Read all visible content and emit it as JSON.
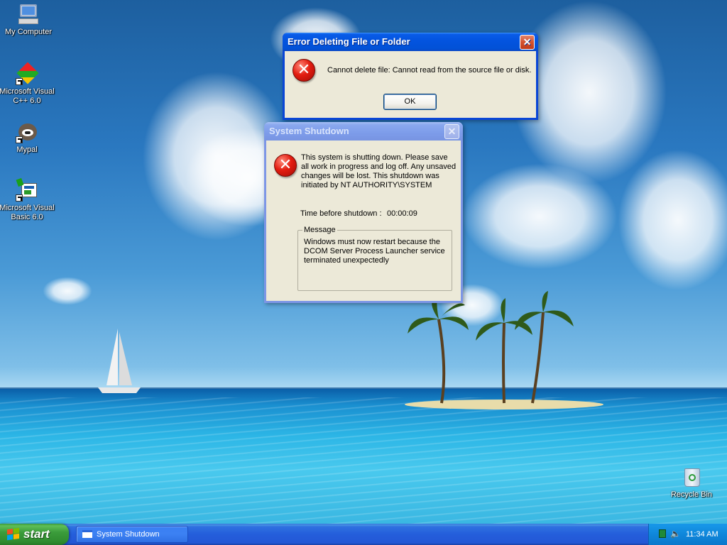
{
  "desktop": {
    "icons": [
      {
        "label": "My Computer",
        "icon": "my-computer-icon"
      },
      {
        "label": "Microsoft Visual C++ 6.0",
        "icon": "visual-cpp-icon"
      },
      {
        "label": "Mypal",
        "icon": "mypal-browser-icon"
      },
      {
        "label": "Microsoft Visual Basic 6.0",
        "icon": "visual-basic-icon"
      },
      {
        "label": "Recycle Bin",
        "icon": "recycle-bin-icon"
      }
    ]
  },
  "error_dialog": {
    "title": "Error Deleting File or Folder",
    "close": "✕",
    "icon": "error-icon",
    "message": "Cannot delete file: Cannot read from the source file or disk.",
    "ok_label": "OK"
  },
  "shutdown_dialog": {
    "title": "System Shutdown",
    "close": "✕",
    "icon": "error-icon",
    "message": "This system is shutting down. Please save all work in progress and log off. Any unsaved changes will be lost. This shutdown was initiated by NT AUTHORITY\\SYSTEM",
    "time_label": "Time before shutdown :",
    "time_value": "00:00:09",
    "message_group_label": "Message",
    "message_group_text": "Windows must now restart because the DCOM Server Process Launcher service terminated unexpectedly"
  },
  "taskbar": {
    "start_label": "start",
    "task_label": "System Shutdown",
    "clock": "11:34 AM",
    "colors": {
      "taskbar": "#245edb",
      "start": "#3b9c3b",
      "tray": "#0f87db"
    }
  }
}
